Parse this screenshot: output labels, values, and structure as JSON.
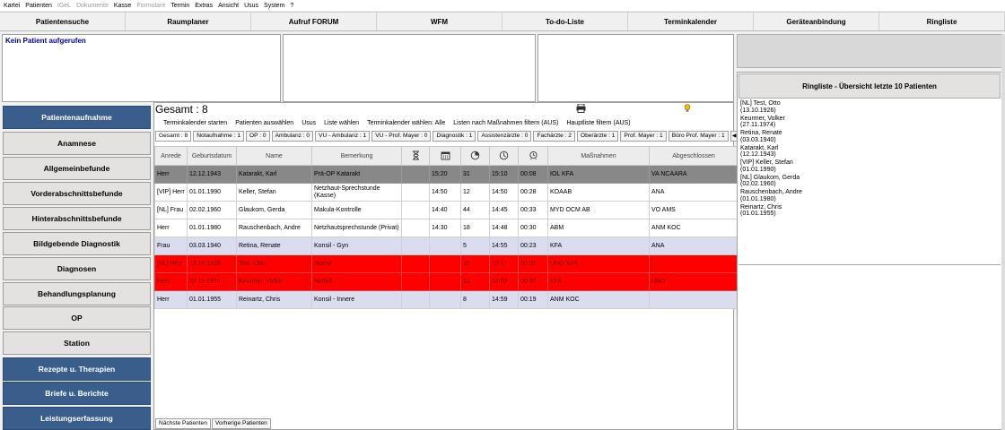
{
  "menu": [
    "Kartei",
    "Patienten",
    "IGeL",
    "Dokumente",
    "Kasse",
    "Formulare",
    "Termin",
    "Extras",
    "Ansicht",
    "Usus",
    "System",
    "?"
  ],
  "menu_disabled": [
    "IGeL",
    "Dokumente",
    "Formulare"
  ],
  "topnav": [
    "Patientensuche",
    "Raumplaner",
    "Aufruf FORUM",
    "WFM",
    "To-do-Liste",
    "Terminkalender",
    "Geräteanbindung",
    "Ringliste"
  ],
  "no_patient": "Kein Patient aufgerufen",
  "sidebar": [
    {
      "label": "Patientenaufnahme",
      "style": "blue"
    },
    {
      "label": "Anamnese",
      "style": "grey"
    },
    {
      "label": "Allgemeinbefunde",
      "style": "grey"
    },
    {
      "label": "Vorderabschnittsbefunde",
      "style": "grey"
    },
    {
      "label": "Hinterabschnittsbefunde",
      "style": "grey"
    },
    {
      "label": "Bildgebende Diagnostik",
      "style": "grey"
    },
    {
      "label": "Diagnosen",
      "style": "grey"
    },
    {
      "label": "Behandlungsplanung",
      "style": "grey"
    },
    {
      "label": "OP",
      "style": "grey"
    },
    {
      "label": "Station",
      "style": "grey"
    },
    {
      "label": "Rezepte u. Therapien",
      "style": "blue"
    },
    {
      "label": "Briefe u. Berichte",
      "style": "blue"
    },
    {
      "label": "Leistungserfassung",
      "style": "blue"
    }
  ],
  "main": {
    "total": "Gesamt : 8",
    "actions": [
      "Terminkalender starten",
      "Patienten auswählen",
      "Usus",
      "Liste wählen",
      "Terminkalender wählen: Alle",
      "Listen nach Maßnahmen filtern (AUS)",
      "Hauptliste filtern (AUS)"
    ],
    "tabs": [
      "Gesamt : 8",
      "Notaufnahme : 1",
      "OP : 0",
      "Ambulanz : 0",
      "VU - Ambulanz : 1",
      "VU - Prof. Mayer : 0",
      "Diagnostik : 1",
      "Assistenzärzte : 0",
      "Fachärzte : 2",
      "Oberärzte : 1",
      "Prof. Mayer : 1",
      "Büro Prof. Mayer : 1"
    ],
    "tab_arrows": [
      "◀",
      "▶"
    ],
    "columns": [
      "Anrede",
      "Geburtsdatum",
      "Name",
      "Bemerkung",
      "hourglass-icon",
      "calendar-icon",
      "timer-icon",
      "clock-icon",
      "alarm-icon",
      "Maßnahmen",
      "Abgeschlossen"
    ],
    "rows": [
      {
        "style": "dark",
        "cells": [
          "Herr",
          "12.12.1943",
          "Katarakt, Karl",
          "Prä-OP Katarakt",
          "",
          "15:20",
          "31",
          "15:10",
          "00:08",
          "IOL KFA",
          "VA NCAARA"
        ]
      },
      {
        "style": "white",
        "cells": [
          "[VIP] Herr",
          "01.01.1990",
          "Keller, Stefan",
          "Netzhaut-Sprechstunde (Kasse)",
          "",
          "14:50",
          "12",
          "14:50",
          "00:28",
          "KOAAB",
          "ANA"
        ]
      },
      {
        "style": "white",
        "cells": [
          "[NL] Frau",
          "02.02.1960",
          "Glaukom, Gerda",
          "Makula-Kontrolle",
          "",
          "14:40",
          "44",
          "14:45",
          "00:33",
          "MYD OCM AB",
          "VO AMS"
        ]
      },
      {
        "style": "white",
        "cells": [
          "Herr",
          "01.01.1980",
          "Rauschenbach, Andre",
          "Netzhautsprechstunde (Privat)",
          "",
          "14:30",
          "18",
          "14:48",
          "00:30",
          "ABM",
          "ANM KOC"
        ]
      },
      {
        "style": "lav",
        "cells": [
          "Frau",
          "03.03.1940",
          "Retina, Renate",
          "Konsil - Gyn",
          "",
          "",
          "5",
          "14:55",
          "00:23",
          "KFA",
          "ANA"
        ]
      },
      {
        "style": "red",
        "cells": [
          "[NL] Herr",
          "13.10.1926",
          "Test, Otto",
          "Notfall",
          "",
          "",
          "10",
          "15:17",
          "00:01",
          "UNO KFA",
          ""
        ]
      },
      {
        "style": "red",
        "cells": [
          "Herr",
          "27.11.1974",
          "Keurmer, Volker",
          "Notfall",
          "",
          "",
          "10",
          "14:52",
          "00:26",
          "KFA",
          "UNO"
        ]
      },
      {
        "style": "lav",
        "cells": [
          "Herr",
          "01.01.1955",
          "Reinartz, Chris",
          "Konsil - Innere",
          "",
          "",
          "8",
          "14:59",
          "00:19",
          "ANM KOC",
          ""
        ]
      }
    ],
    "bottom_tabs": [
      "Nächste Patienten",
      "Vorherige Patienten"
    ]
  },
  "ringliste": {
    "title": "Ringliste - Übersicht letzte 10 Patienten",
    "items": [
      {
        "name": "[NL] Test, Otto",
        "dob": "(13.10.1926)"
      },
      {
        "name": "Keurmer, Volker",
        "dob": "(27.11.1974)"
      },
      {
        "name": "Retina, Renate",
        "dob": "(03.03.1940)"
      },
      {
        "name": "Katarakt, Karl",
        "dob": "(12.12.1943)"
      },
      {
        "name": "[VIP] Keller, Stefan",
        "dob": "(01.01.1990)"
      },
      {
        "name": "[NL] Glaukom, Gerda",
        "dob": "(02.02.1960)"
      },
      {
        "name": "Rauschenbach, Andre",
        "dob": "(01.01.1980)"
      },
      {
        "name": "Reinartz, Chris",
        "dob": "(01.01.1955)"
      }
    ]
  },
  "colors": {
    "blue_button": "#3a5e8c",
    "grey_button": "#e4e2e0",
    "dark_row": "#888888",
    "red_row": "#ff0000",
    "lavender_row": "#dcdcf0",
    "no_patient_text": "#0000a0"
  }
}
